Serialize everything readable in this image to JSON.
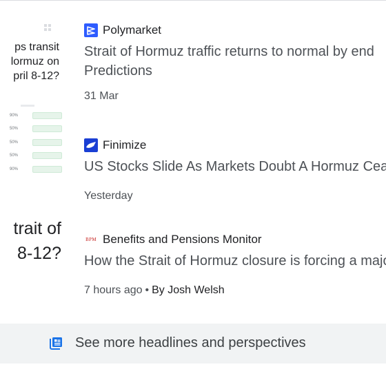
{
  "featured": {
    "thumb_lines": [
      "ps transit",
      "lormuz on",
      "pril 8-12?"
    ],
    "table_rows": [
      "90%",
      "50%",
      "50%",
      "50%",
      "90%"
    ],
    "title_lines": [
      "trait of",
      "8-12?"
    ]
  },
  "items": [
    {
      "source": "Polymarket",
      "logo_icon": "polymarket-logo",
      "logo_color": "#2e5cff",
      "headline": "Strait of Hormuz traffic returns to normal by end",
      "headline_line2": "Predictions",
      "time": "31 Mar",
      "author": ""
    },
    {
      "source": "Finimize",
      "logo_icon": "finimize-logo",
      "logo_color": "#1a3fd4",
      "headline": "US Stocks Slide As Markets Doubt A Hormuz Ceasefire",
      "time": "Yesterday",
      "author": ""
    },
    {
      "source": "Benefits and Pensions Monitor",
      "logo_text": "BPM",
      "logo_color": "#c5221f",
      "headline": "How the Strait of Hormuz closure is forcing a major",
      "time": "7 hours ago",
      "separator": "•",
      "author": "By Josh Welsh"
    }
  ],
  "more": {
    "label": "See more headlines and perspectives",
    "icon": "news-icon",
    "icon_color": "#1a73e8"
  }
}
